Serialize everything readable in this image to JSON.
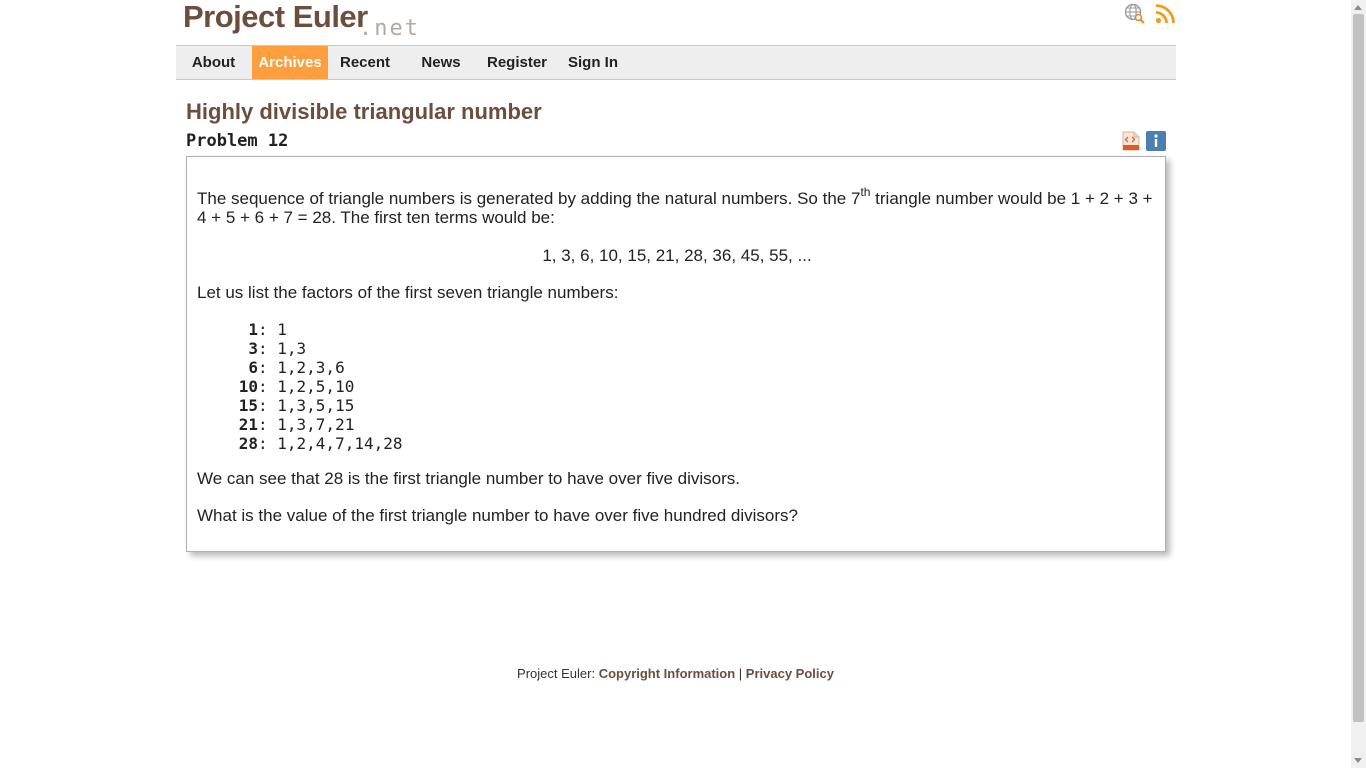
{
  "header": {
    "logo_main": "Project Euler",
    "logo_net": ".net",
    "icons": [
      "globe-search-icon",
      "rss-icon"
    ]
  },
  "nav": {
    "items": [
      {
        "label": "About"
      },
      {
        "label": "Archives",
        "active": true
      },
      {
        "label": "Recent"
      },
      {
        "label": "News"
      },
      {
        "label": "Register"
      },
      {
        "label": "Sign In"
      }
    ]
  },
  "problem": {
    "title": "Highly divisible triangular number",
    "number": "Problem 12",
    "icons": [
      "html-source-icon",
      "info-icon"
    ],
    "p1_before": "The sequence of triangle numbers is generated by adding the natural numbers. So the 7",
    "p1_sup": "th",
    "p1_after": " triangle number would be 1 + 2 + 3 + 4 + 5 + 6 + 7 = 28. The first ten terms would be:",
    "sequence": "1, 3, 6, 10, 15, 21, 28, 36, 45, 55, ...",
    "p2": "Let us list the factors of the first seven triangle numbers:",
    "factors": [
      {
        "n": "1",
        "f": "1"
      },
      {
        "n": "3",
        "f": "1,3"
      },
      {
        "n": "6",
        "f": "1,2,3,6"
      },
      {
        "n": "10",
        "f": "1,2,5,10"
      },
      {
        "n": "15",
        "f": "1,3,5,15"
      },
      {
        "n": "21",
        "f": "1,3,7,21"
      },
      {
        "n": "28",
        "f": "1,2,4,7,14,28"
      }
    ],
    "p3": "We can see that 28 is the first triangle number to have over five divisors.",
    "p4": "What is the value of the first triangle number to have over five hundred divisors?"
  },
  "footer": {
    "prefix": "Project Euler: ",
    "copyright": "Copyright Information",
    "sep": " | ",
    "privacy": "Privacy Policy"
  },
  "colors": {
    "brand": "#6b4e3d",
    "accent": "#ff9e3d",
    "info": "#4a7fb0"
  }
}
